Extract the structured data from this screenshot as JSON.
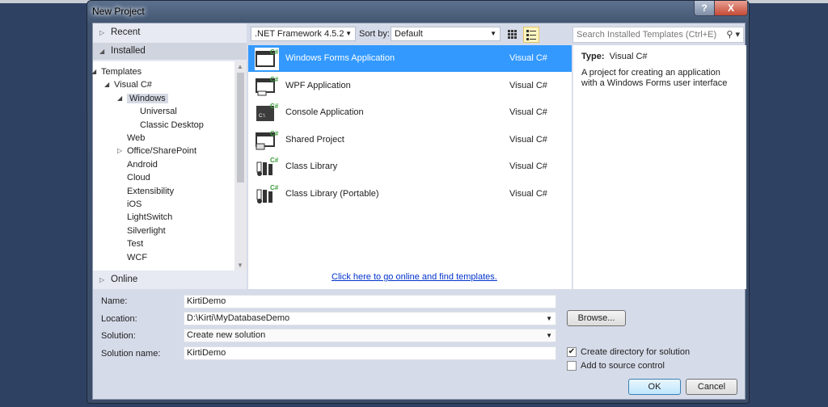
{
  "window": {
    "title": "New Project",
    "help": "?",
    "close": "X"
  },
  "left": {
    "recent": "Recent",
    "installed": "Installed",
    "online": "Online",
    "tree": [
      {
        "label": "Templates",
        "level": 0,
        "exp": "open"
      },
      {
        "label": "Visual C#",
        "level": 1,
        "exp": "open"
      },
      {
        "label": "Windows",
        "level": 2,
        "exp": "open",
        "selected": true
      },
      {
        "label": "Universal",
        "level": 3
      },
      {
        "label": "Classic Desktop",
        "level": 3
      },
      {
        "label": "Web",
        "level": 2
      },
      {
        "label": "Office/SharePoint",
        "level": 2,
        "exp": "closed"
      },
      {
        "label": "Android",
        "level": 2
      },
      {
        "label": "Cloud",
        "level": 2
      },
      {
        "label": "Extensibility",
        "level": 2
      },
      {
        "label": "iOS",
        "level": 2
      },
      {
        "label": "LightSwitch",
        "level": 2
      },
      {
        "label": "Silverlight",
        "level": 2
      },
      {
        "label": "Test",
        "level": 2
      },
      {
        "label": "WCF",
        "level": 2
      }
    ]
  },
  "toolbar": {
    "framework": ".NET Framework 4.5.2",
    "sort_label": "Sort by:",
    "sort_value": "Default",
    "search_placeholder": "Search Installed Templates (Ctrl+E)"
  },
  "templates": [
    {
      "name": "Windows Forms Application",
      "lang": "Visual C#",
      "icon": "winforms-icon"
    },
    {
      "name": "WPF Application",
      "lang": "Visual C#",
      "icon": "wpf-icon"
    },
    {
      "name": "Console Application",
      "lang": "Visual C#",
      "icon": "console-icon"
    },
    {
      "name": "Shared Project",
      "lang": "Visual C#",
      "icon": "shared-icon"
    },
    {
      "name": "Class Library",
      "lang": "Visual C#",
      "icon": "library-icon"
    },
    {
      "name": "Class Library (Portable)",
      "lang": "Visual C#",
      "icon": "library-icon"
    }
  ],
  "online_link": "Click here to go online and find templates.",
  "details": {
    "type_label": "Type:",
    "type_value": "Visual C#",
    "description": "A project for creating an application with a Windows Forms user interface"
  },
  "form": {
    "name_label": "Name:",
    "name": "KirtiDemo",
    "location_label": "Location:",
    "location": "D:\\Kirti\\MyDatabaseDemo",
    "solution_label": "Solution:",
    "solution": "Create new solution",
    "solution_name_label": "Solution name:",
    "solution_name": "KirtiDemo",
    "browse": "Browse...",
    "create_dir": "Create directory for solution",
    "create_dir_checked": true,
    "source_control": "Add to source control",
    "source_control_checked": false,
    "ok": "OK",
    "cancel": "Cancel"
  },
  "colors": {
    "accent": "#3399ff",
    "background": "#2f4162",
    "csharp": "#3a9b3a"
  }
}
